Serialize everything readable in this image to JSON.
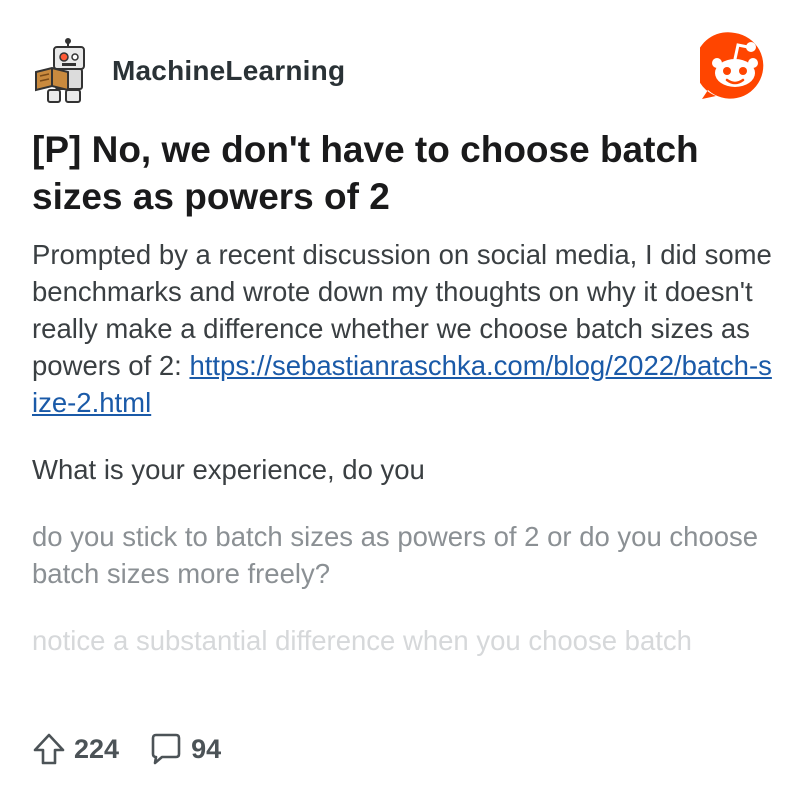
{
  "subreddit": {
    "name": "MachineLearning",
    "avatar_icon": "robot-reading-book-icon",
    "brand_icon": "reddit-snoo-icon",
    "brand_color": "#ff4500"
  },
  "post": {
    "title": "[P] No, we don't have to choose batch sizes as powers of 2",
    "body_intro": "Prompted by a recent discussion on social media, I did some benchmarks and wrote down my thoughts on why it doesn't really make a difference whether we choose batch sizes as powers of 2:",
    "link": "https://sebastianraschka.com/blog/2022/batch-size-2.html",
    "question": "What is your experience, do you",
    "bullet_1": "do you stick to batch sizes as powers of 2 or do you choose batch sizes more freely?",
    "bullet_2": "notice a substantial difference when you choose batch",
    "link_color": "#1a5aa8"
  },
  "stats": {
    "upvotes": "224",
    "comments": "94",
    "upvote_icon": "upvote-arrow-icon",
    "comment_icon": "comment-bubble-icon"
  }
}
